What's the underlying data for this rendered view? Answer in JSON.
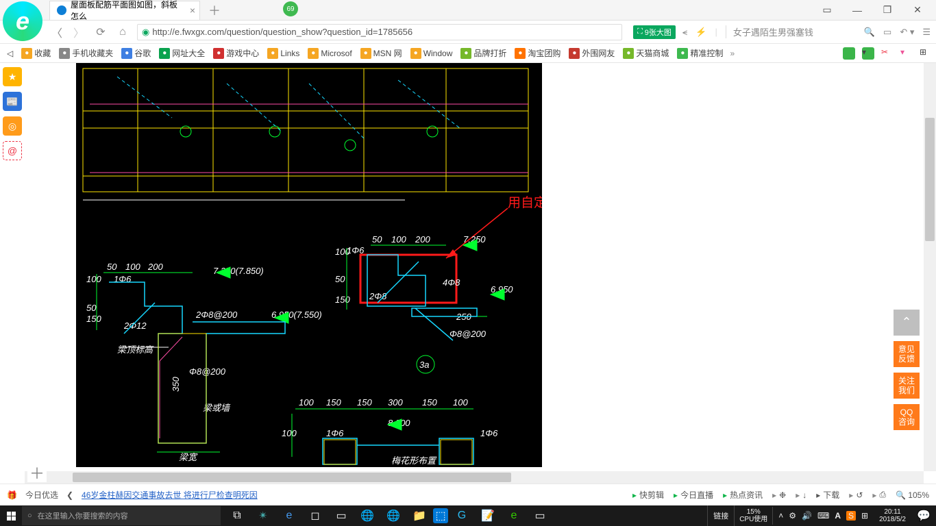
{
  "window": {
    "title": "屋面板配筋平面图如图，斜板怎么",
    "badge": "69",
    "controls": {
      "minimize": "—",
      "restoreGlyph": "❐",
      "close": "✕"
    }
  },
  "address": {
    "url": "http://e.fwxgx.com/question/question_show?question_id=1785656",
    "badge": "9张大图",
    "search_placeholder": "女子遇陌生男强塞钱"
  },
  "bookmarks": {
    "nav_left": "◁",
    "items": [
      {
        "label": "收藏",
        "color": "#f5a623"
      },
      {
        "label": "手机收藏夹",
        "color": "#888"
      },
      {
        "label": "谷歌",
        "color": "#3f7fe2"
      },
      {
        "label": "网址大全",
        "color": "#0aa24e"
      },
      {
        "label": "游戏中心",
        "color": "#d03030"
      },
      {
        "label": "Links",
        "color": "#f5a623"
      },
      {
        "label": "Microsof",
        "color": "#f5a623"
      },
      {
        "label": "MSN 网",
        "color": "#f5a623"
      },
      {
        "label": "Window",
        "color": "#f5a623"
      },
      {
        "label": "品牌打折",
        "color": "#76b82a"
      },
      {
        "label": "淘宝团购",
        "color": "#ff7200"
      },
      {
        "label": "外围网友",
        "color": "#c53a2f"
      },
      {
        "label": "天猫商城",
        "color": "#76b82a"
      },
      {
        "label": "精准控制",
        "color": "#3eb94f"
      }
    ],
    "more": "»"
  },
  "cad": {
    "annotation": "用自定义线定义",
    "top_dims": [
      "50",
      "100",
      "200"
    ],
    "right_elev_top": "7.250",
    "label_1phi6_a": "1Φ6",
    "label_4phi8": "4Φ8",
    "label_2phi8": "2Φ8",
    "left_dims_a": [
      "150",
      "50",
      "100"
    ],
    "right_elev_b": "6.950",
    "bottom_dim_250": "250",
    "phi8_200_b": "Φ8@200",
    "mark_3a": "3a",
    "sec_left_dims": [
      "50",
      "100",
      "200"
    ],
    "sec_left_elev": "7.250(7.850)",
    "sec_left_1phi6": "1Φ6",
    "sec_left_100": "100",
    "sec_left_150_50": [
      "150",
      "50"
    ],
    "sec_left_2phi12": "2Φ12",
    "sec_left_2phi8": "2Φ8@200",
    "sec_elev2": "6.950(7.550)",
    "sec_phi8c": "Φ8@200",
    "sec_350": "350",
    "sec_lt1": "梁顶标高",
    "sec_lt2": "梁或墙",
    "sec_lt3": "梁宽",
    "bot_dims": [
      "100",
      "150",
      "150",
      "300",
      "150",
      "100"
    ],
    "bot_elev": "8.200",
    "bot_1phi6_l": "1Φ6",
    "bot_1phi6_r": "1Φ6",
    "bot_100": "100",
    "bot_label": "梅花形布置"
  },
  "right_buttons": {
    "top": "⌃",
    "b1": "意见\n反馈",
    "b2": "关注\n我们",
    "b3": "QQ\n咨询"
  },
  "footer": {
    "left1": "今日优选",
    "chev": "❮",
    "news": "46岁金柱赫因交通事故去世 将进行尸检查明死因",
    "items": [
      "快剪辑",
      "今日直播",
      "热点资讯",
      "❉",
      "↓",
      "下载",
      "↺",
      "⎙"
    ],
    "zoom": "105%"
  },
  "taskbar": {
    "search_placeholder": "在这里输入你要搜索的内容",
    "lang": "链接",
    "cpu_pct": "15%",
    "cpu_label": "CPU使用",
    "time": "20:11",
    "date": "2018/5/2"
  },
  "chart_data": {
    "type": "diagram",
    "description": "CAD structural reinforcement section details",
    "annotations": [
      "用自定义线定义"
    ],
    "sections": [
      {
        "id": "3a",
        "dims_mm": [
          50,
          100,
          200
        ],
        "top_elev": 7.25,
        "rebar": [
          "1Φ6",
          "4Φ8",
          "2Φ8"
        ],
        "side_dims": [
          150,
          50,
          100
        ],
        "bottom_elev": 6.95,
        "stirrup": "Φ8@200",
        "offset": 250
      },
      {
        "id": "left",
        "dims_mm": [
          50,
          100,
          200
        ],
        "top_elev": "7.250(7.850)",
        "rebar": [
          "1Φ6",
          "2Φ12",
          "2Φ8@200"
        ],
        "side_dims": [
          150,
          50,
          100
        ],
        "mid_elev": "6.950(7.550)",
        "stirrup": "Φ8@200",
        "depth": 350
      },
      {
        "id": "bottom",
        "dims_mm": [
          100,
          150,
          150,
          300,
          150,
          100
        ],
        "top_elev": 8.2,
        "rebar": [
          "1Φ6",
          "1Φ6"
        ],
        "note": "梅花形布置"
      }
    ]
  }
}
